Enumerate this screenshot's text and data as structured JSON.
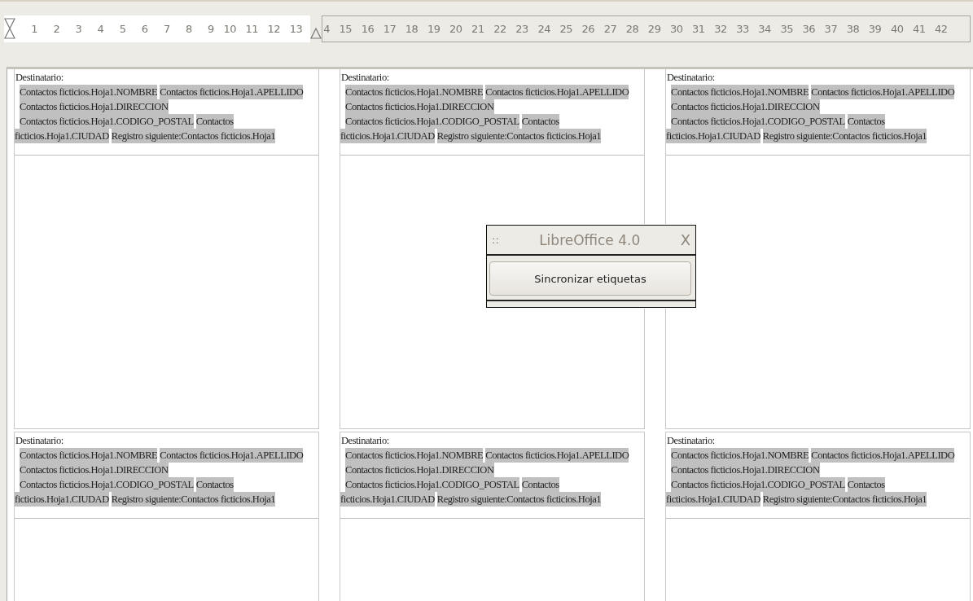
{
  "ruler": {
    "left_numbers": [
      "1",
      "2",
      "3",
      "4",
      "5",
      "6",
      "7",
      "8",
      "9",
      "10",
      "11",
      "12",
      "13"
    ],
    "right_numbers": [
      "4",
      "15",
      "16",
      "17",
      "18",
      "19",
      "20",
      "21",
      "22",
      "23",
      "24",
      "25",
      "26",
      "27",
      "28",
      "29",
      "30",
      "31",
      "32",
      "33",
      "34",
      "35",
      "36",
      "37",
      "38",
      "39",
      "40",
      "41",
      "42"
    ]
  },
  "labels": [
    {
      "heading": "Destinatario:",
      "lines": [
        {
          "kind": "indented",
          "fields": [
            "Contactos ficticios.Hoja1.NOMBRE",
            "Contactos ficticios.Hoja1.APELLIDO"
          ]
        },
        {
          "kind": "indented",
          "fields": [
            "Contactos ficticios.Hoja1.DIRECCION"
          ]
        },
        {
          "kind": "indented",
          "fields": [
            "Contactos ficticios.Hoja1.CODIGO_POSTAL",
            "Contactos"
          ]
        },
        {
          "kind": "flush",
          "fields": [
            "ficticios.Hoja1.CIUDAD",
            "Registro siguiente:Contactos ficticios.Hoja1"
          ]
        }
      ]
    },
    {
      "heading": "Destinatario:",
      "lines": [
        {
          "kind": "indented",
          "fields": [
            "Contactos ficticios.Hoja1.NOMBRE",
            "Contactos ficticios.Hoja1.APELLIDO"
          ]
        },
        {
          "kind": "indented",
          "fields": [
            "Contactos ficticios.Hoja1.DIRECCION"
          ]
        },
        {
          "kind": "indented",
          "fields": [
            "Contactos ficticios.Hoja1.CODIGO_POSTAL",
            "Contactos"
          ]
        },
        {
          "kind": "flush",
          "fields": [
            "ficticios.Hoja1.CIUDAD",
            "Registro siguiente:Contactos ficticios.Hoja1"
          ]
        }
      ]
    },
    {
      "heading": "Destinatario:",
      "lines": [
        {
          "kind": "indented",
          "fields": [
            "Contactos ficticios.Hoja1.NOMBRE",
            "Contactos ficticios.Hoja1.APELLIDO"
          ]
        },
        {
          "kind": "indented",
          "fields": [
            "Contactos ficticios.Hoja1.DIRECCION"
          ]
        },
        {
          "kind": "indented",
          "fields": [
            "Contactos ficticios.Hoja1.CODIGO_POSTAL",
            "Contactos"
          ]
        },
        {
          "kind": "flush",
          "fields": [
            "ficticios.Hoja1.CIUDAD",
            "Registro siguiente:Contactos ficticios.Hoja1"
          ]
        }
      ]
    },
    {
      "heading": "Destinatario:",
      "lines": [
        {
          "kind": "indented",
          "fields": [
            "Contactos ficticios.Hoja1.NOMBRE",
            "Contactos ficticios.Hoja1.APELLIDO"
          ]
        },
        {
          "kind": "indented",
          "fields": [
            "Contactos ficticios.Hoja1.DIRECCION"
          ]
        },
        {
          "kind": "indented",
          "fields": [
            "Contactos ficticios.Hoja1.CODIGO_POSTAL",
            "Contactos"
          ]
        },
        {
          "kind": "flush",
          "fields": [
            "ficticios.Hoja1.CIUDAD",
            "Registro siguiente:Contactos ficticios.Hoja1"
          ]
        }
      ]
    },
    {
      "heading": "Destinatario:",
      "lines": [
        {
          "kind": "indented",
          "fields": [
            "Contactos ficticios.Hoja1.NOMBRE",
            "Contactos ficticios.Hoja1.APELLIDO"
          ]
        },
        {
          "kind": "indented",
          "fields": [
            "Contactos ficticios.Hoja1.DIRECCION"
          ]
        },
        {
          "kind": "indented",
          "fields": [
            "Contactos ficticios.Hoja1.CODIGO_POSTAL",
            "Contactos"
          ]
        },
        {
          "kind": "flush",
          "fields": [
            "ficticios.Hoja1.CIUDAD",
            "Registro siguiente:Contactos ficticios.Hoja1"
          ]
        }
      ]
    },
    {
      "heading": "Destinatario:",
      "lines": [
        {
          "kind": "indented",
          "fields": [
            "Contactos ficticios.Hoja1.NOMBRE",
            "Contactos ficticios.Hoja1.APELLIDO"
          ]
        },
        {
          "kind": "indented",
          "fields": [
            "Contactos ficticios.Hoja1.DIRECCION"
          ]
        },
        {
          "kind": "indented",
          "fields": [
            "Contactos ficticios.Hoja1.CODIGO_POSTAL",
            "Contactos"
          ]
        },
        {
          "kind": "flush",
          "fields": [
            "ficticios.Hoja1.CIUDAD",
            "Registro siguiente:Contactos ficticios.Hoja1"
          ]
        }
      ]
    }
  ],
  "dialog": {
    "grip": "::",
    "title": "LibreOffice 4.0",
    "close": "X",
    "button": "Sincronizar etiquetas"
  }
}
